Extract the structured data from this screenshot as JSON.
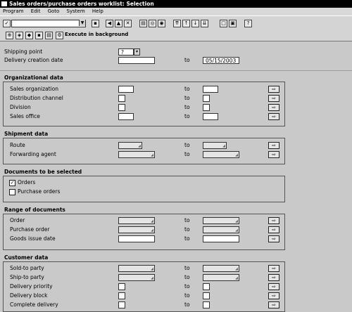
{
  "window": {
    "title": "Sales orders/purchase orders worklist: Selection"
  },
  "menu": [
    "Program",
    "Edit",
    "Goto",
    "System",
    "Help"
  ],
  "toolbar2": {
    "execute_bg": "Execute in background"
  },
  "header_fields": {
    "shipping_point": {
      "label": "Shipping point",
      "value": "?"
    },
    "delivery_creation_date": {
      "label": "Delivery creation date",
      "to_label": "to",
      "to_value": "05/15/2003"
    }
  },
  "org": {
    "title": "Organizational data",
    "rows": [
      {
        "label": "Sales organization",
        "to": "to"
      },
      {
        "label": "Distribution channel",
        "to": "to"
      },
      {
        "label": "Division",
        "to": "to"
      },
      {
        "label": "Sales office",
        "to": "to"
      }
    ]
  },
  "shipment": {
    "title": "Shipment data",
    "rows": [
      {
        "label": "Route",
        "to": "to"
      },
      {
        "label": "Forwarding agent",
        "to": "to"
      }
    ]
  },
  "docs": {
    "title": "Documents to be selected",
    "orders": {
      "label": "Orders",
      "checked": true
    },
    "purchase_orders": {
      "label": "Purchase orders",
      "checked": false
    }
  },
  "range": {
    "title": "Range of documents",
    "rows": [
      {
        "label": "Order",
        "to": "to"
      },
      {
        "label": "Purchase order",
        "to": "to"
      },
      {
        "label": "Goods issue date",
        "to": "to"
      }
    ]
  },
  "customer": {
    "title": "Customer data",
    "rows": [
      {
        "label": "Sold-to party",
        "to": "to"
      },
      {
        "label": "Ship-to party",
        "to": "to"
      },
      {
        "label": "Delivery priority",
        "to": "to"
      },
      {
        "label": "Delivery block",
        "to": "to"
      },
      {
        "label": "Complete delivery",
        "to": "to"
      }
    ]
  }
}
